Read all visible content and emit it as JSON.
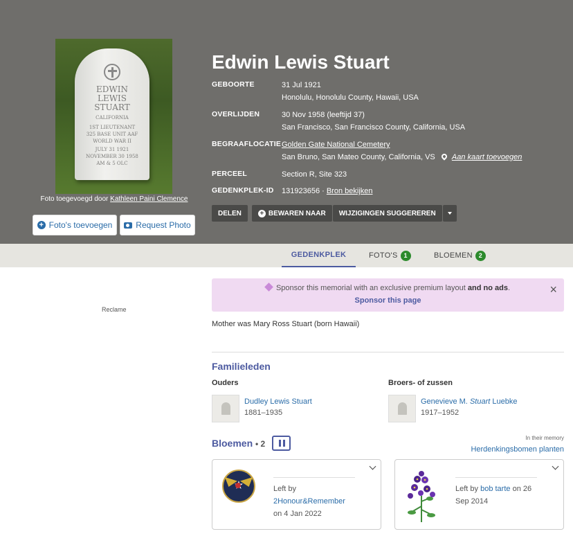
{
  "headstone": {
    "lines": [
      "EDWIN",
      "LEWIS",
      "STUART",
      "CALIFORNIA",
      "1ST LIEUTENANT",
      "325 BASE UNIT AAF",
      "WORLD WAR II",
      "JULY 31 1921",
      "NOVEMBER 30 1958",
      "AM & 5 OLC"
    ]
  },
  "photo": {
    "credit_prefix": "Foto toegevoegd door",
    "credit_name": "Kathleen Paini Clemence",
    "add_photos": "Foto's toevoegen",
    "request_photo": "Request Photo"
  },
  "person": {
    "name": "Edwin Lewis Stuart",
    "facts": [
      {
        "label": "GEBOORTE",
        "line1": "31 Jul 1921",
        "line2": "Honolulu, Honolulu County, Hawaii, USA"
      },
      {
        "label": "OVERLIJDEN",
        "line1": "30 Nov 1958 (leeftijd 37)",
        "line2": "San Francisco, San Francisco County, California, USA"
      },
      {
        "label": "BEGRAAFLOCATIE",
        "link": "Golden Gate National Cemetery",
        "line2": "San Bruno, San Mateo County, California, VS",
        "map_link": "Aan kaart toevoegen"
      },
      {
        "label": "PERCEEL",
        "line1": "Section R, Site 323"
      },
      {
        "label": "GEDENKPLEK-ID",
        "line1": "131923656 ·",
        "link": "Bron bekijken"
      }
    ]
  },
  "toolbar": {
    "share": "DELEN",
    "save": "BEWAREN NAAR",
    "suggest": "WIJZIGINGEN SUGGEREREN"
  },
  "tabs": [
    {
      "label": "GEDENKPLEK"
    },
    {
      "label": "FOTO'S",
      "count": "1"
    },
    {
      "label": "BLOEMEN",
      "count": "2"
    }
  ],
  "ad": {
    "label": "Reclame"
  },
  "sponsor": {
    "text": "Sponsor this memorial with an exclusive premium layout",
    "bold": "and no ads",
    "end": ".",
    "link": "Sponsor this page",
    "close": "×"
  },
  "bio": "Mother was Mary Ross Stuart (born Hawaii)",
  "family": {
    "title": "Familieleden",
    "parents_label": "Ouders",
    "siblings_label": "Broers- of zussen",
    "parent": {
      "name": "Dudley Lewis Stuart",
      "years": "1881–1935"
    },
    "sibling": {
      "name_pre": "Genevieve M.",
      "name_em": "Stuart",
      "name_post": "Luebke",
      "years": "1917–1952"
    }
  },
  "flowers": {
    "title": "Bloemen",
    "count": "• 2",
    "memory_label": "In their memory",
    "trees_link": "Herdenkingsbomen planten",
    "cards": [
      {
        "left_by": "Left by",
        "by": "2Honour&Remember",
        "on": "on 4 Jan 2022"
      },
      {
        "left_by": "Left by",
        "by": "bob tarte",
        "on_pre": "on 26",
        "on_post": "Sep 2014"
      }
    ]
  },
  "colors": {
    "header_bg": "#6f6e6b",
    "accent": "#4c5aa0",
    "link": "#2a6ca8",
    "sponsor_bg": "#f0daf2",
    "badge_green": "#2c8a2c"
  }
}
